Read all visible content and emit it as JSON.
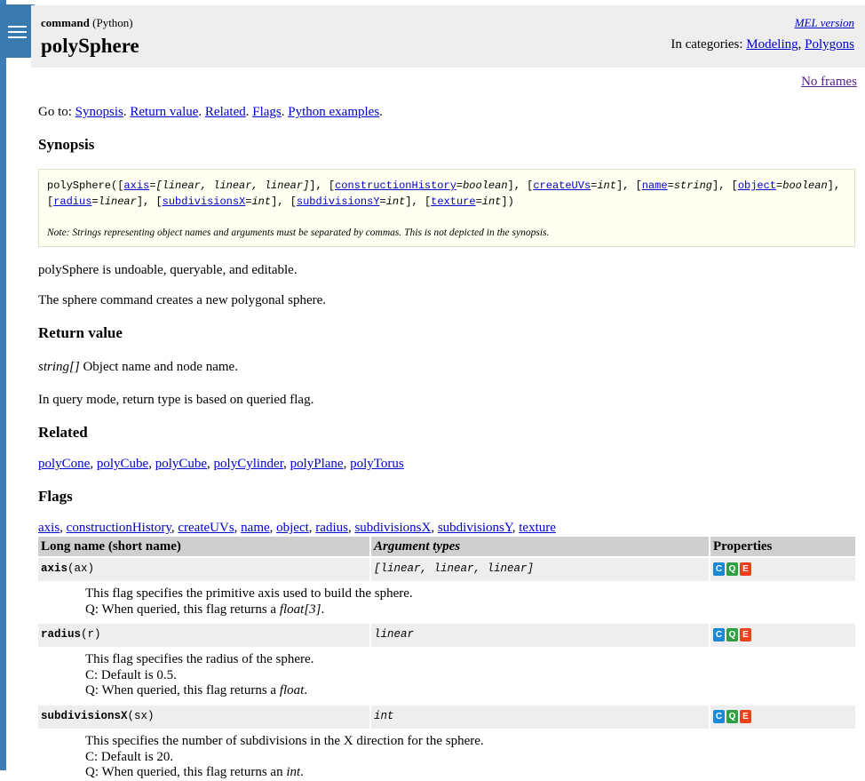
{
  "header": {
    "kind_bold": "command",
    "kind_lang": "(Python)",
    "title": "polySphere",
    "mel_link": "MEL version",
    "categories_label": "In categories:",
    "categories": [
      "Modeling",
      "Polygons"
    ]
  },
  "no_frames": "No frames",
  "goto": {
    "label": "Go to:",
    "links": [
      "Synopsis",
      "Return value",
      "Related",
      "Flags",
      "Python examples"
    ]
  },
  "synopsis": {
    "heading": "Synopsis",
    "note": "Note: Strings representing object names and arguments must be separated by commas. This is not depicted in the synopsis."
  },
  "undoable_text": "polySphere is undoable, queryable, and editable.",
  "description": "The sphere command creates a new polygonal sphere.",
  "return_value": {
    "heading": "Return value",
    "type": "string[]",
    "text": "Object name and node name.",
    "query_text": "In query mode, return type is based on queried flag."
  },
  "related": {
    "heading": "Related",
    "links": [
      "polyCone",
      "polyCube",
      "polyCube",
      "polyCylinder",
      "polyPlane",
      "polyTorus"
    ]
  },
  "flags": {
    "heading": "Flags",
    "links": [
      "axis",
      "constructionHistory",
      "createUVs",
      "name",
      "object",
      "radius",
      "subdivisionsX",
      "subdivisionsY",
      "texture"
    ],
    "columns": [
      "Long name (short name)",
      "Argument types",
      "Properties"
    ],
    "badges": [
      "C",
      "Q",
      "E"
    ],
    "rows": [
      {
        "long": "axis",
        "short": "(ax)",
        "arg": "[linear, linear, linear]",
        "desc1": "This flag specifies the primitive axis used to build the sphere.",
        "desc2_pre": "Q: When queried, this flag returns a ",
        "desc2_em": "float[3]",
        "desc2_post": "."
      },
      {
        "long": "radius",
        "short": "(r)",
        "arg": "linear",
        "desc1": "This flag specifies the radius of the sphere.",
        "desc_default": "C: Default is 0.5.",
        "desc2_pre": "Q: When queried, this flag returns a ",
        "desc2_em": "float",
        "desc2_post": "."
      },
      {
        "long": "subdivisionsX",
        "short": "(sx)",
        "arg": "int",
        "desc1": "This specifies the number of subdivisions in the X direction for the sphere.",
        "desc_default": "C: Default is 20.",
        "desc2_pre": "Q: When queried, this flag returns an ",
        "desc2_em": "int",
        "desc2_post": "."
      }
    ]
  }
}
